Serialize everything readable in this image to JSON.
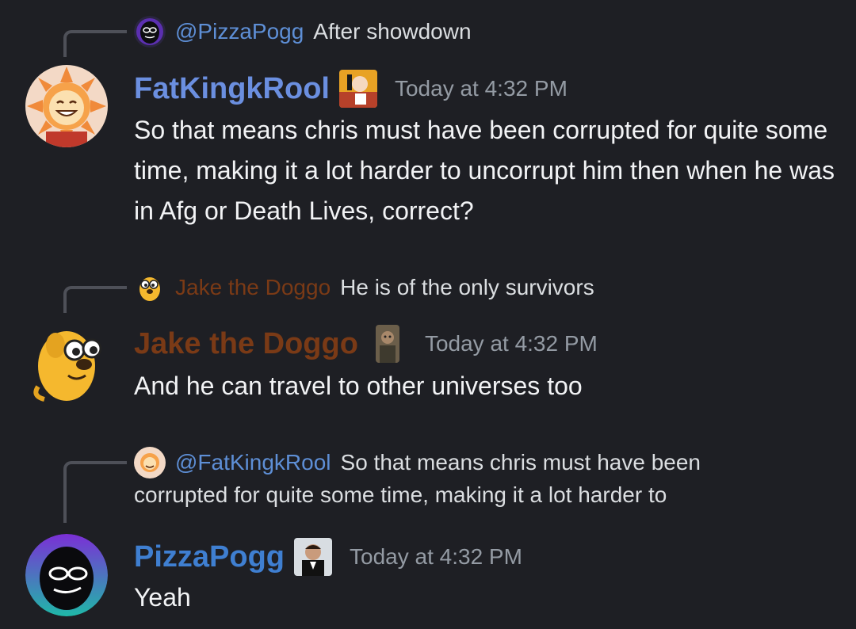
{
  "messages": [
    {
      "reply": {
        "mention": "@PizzaPogg",
        "text": "After showdown"
      },
      "author": "FatKingkRool",
      "timestamp": "Today at 4:32 PM",
      "text": "So that means chris must have been corrupted for quite some time, making it a lot harder to uncorrupt him then when he was in Afg or Death Lives, correct?"
    },
    {
      "reply": {
        "name": "Jake the Doggo",
        "text": "He is of the only survivors"
      },
      "author": "Jake the Doggo",
      "timestamp": "Today at 4:32 PM",
      "text": "And he can travel to other universes too"
    },
    {
      "reply": {
        "mention": "@FatKingkRool",
        "text": "So that means chris must have been",
        "text_line2": "corrupted for quite some time, making it a lot harder to"
      },
      "author": "PizzaPogg",
      "timestamp": "Today at 4:32 PM",
      "text": "Yeah"
    }
  ],
  "colors": {
    "background": "#1e1f24",
    "fatkingkrool_name": "#6b8fe0",
    "jake_name": "#7a3a16",
    "pizzapogg_name": "#3f7fd1",
    "mention": "#5e8fd6",
    "timestamp": "#949ba4",
    "text": "#f2f3f5"
  }
}
